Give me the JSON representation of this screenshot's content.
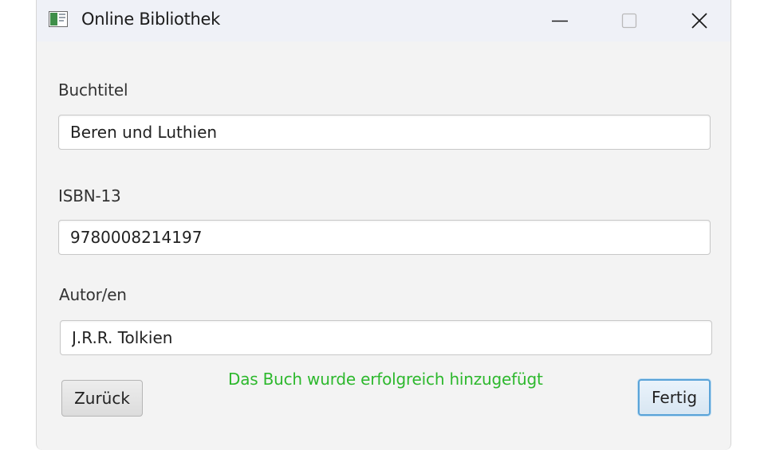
{
  "window": {
    "title": "Online Bibliothek"
  },
  "form": {
    "title_label": "Buchtitel",
    "title_value": "Beren und Luthien",
    "isbn_label": "ISBN-13",
    "isbn_value": "9780008214197",
    "author_label": "Autor/en",
    "author_value": "J.R.R. Tolkien"
  },
  "status": {
    "message": "Das Buch wurde erfolgreich hinzugefügt",
    "color": "#2db82d"
  },
  "buttons": {
    "back_label": "Zurück",
    "done_label": "Fertig"
  },
  "icons": {
    "app": "book-app-icon",
    "minimize": "minimize-icon",
    "maximize": "maximize-icon",
    "close": "close-icon"
  },
  "colors": {
    "titlebar": "#eff1f7",
    "window_bg": "#f3f3f3",
    "focus_accent": "#5aa3d8"
  }
}
